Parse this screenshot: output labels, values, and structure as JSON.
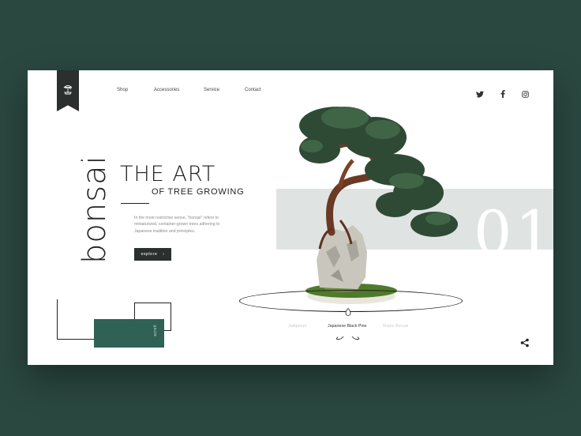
{
  "nav": {
    "items": [
      "Shop",
      "Accessories",
      "Service",
      "Contact"
    ]
  },
  "social": [
    "twitter-icon",
    "facebook-icon",
    "instagram-icon"
  ],
  "hero": {
    "vertical_word": "bonsai",
    "title": "THE ART",
    "subtitle": "OF TREE GROWING",
    "description": "In the most restrictive sense, \"bonsai\" refers to miniaturized, container-grown trees adhering to Japanese tradition and principles.",
    "explore_label": "explore",
    "explore_arrow": "›",
    "scroll_label": "scroll"
  },
  "slide": {
    "number": "01"
  },
  "carousel": {
    "prev": "Juniperus",
    "current": "Japanese Black Pine",
    "next": "Maple Bonsai"
  },
  "colors": {
    "background": "#2a4740",
    "accent_green": "#2f6155",
    "dark": "#2b2f2e",
    "band": "#dfe4e3"
  }
}
